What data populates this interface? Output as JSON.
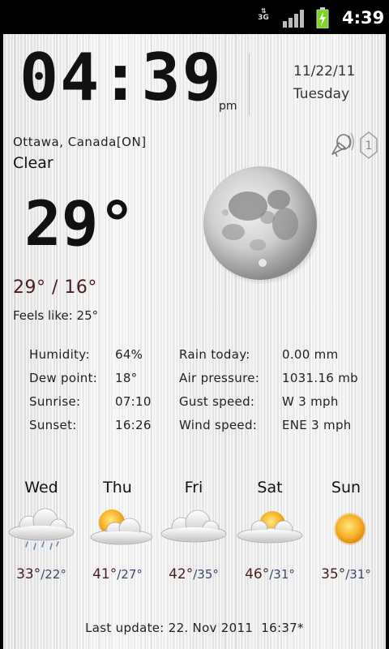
{
  "status_bar": {
    "network": "3G",
    "time": "4:39",
    "colors": {
      "battery": "#7ed321"
    }
  },
  "clock": {
    "time": "04:39",
    "ampm": "pm",
    "date": "11/22/11",
    "weekday": "Tuesday"
  },
  "current": {
    "location": "Ottawa, Canada[ON]",
    "condition": "Clear",
    "temperature": "29°",
    "high": "29°",
    "separator": " / ",
    "low": "16°",
    "feels_like": "Feels like: 25°",
    "icon": "full-moon-icon",
    "alert_count": "1"
  },
  "details_left": [
    {
      "label": "Humidity:",
      "value": "64%"
    },
    {
      "label": "Dew point:",
      "value": "18°"
    },
    {
      "label": "Sunrise:",
      "value": "07:10"
    },
    {
      "label": "Sunset:",
      "value": "16:26"
    }
  ],
  "details_right": [
    {
      "label": "Rain today:",
      "value": "0.00 mm"
    },
    {
      "label": "Air pressure:",
      "value": "1031.16 mb"
    },
    {
      "label": "Gust speed:",
      "value": "W 3 mph"
    },
    {
      "label": "Wind speed:",
      "value": "ENE 3 mph"
    }
  ],
  "forecast": [
    {
      "day": "Wed",
      "hi": "33°",
      "lo": "/22°",
      "icon": "rain-cloud-icon"
    },
    {
      "day": "Thu",
      "hi": "41°",
      "lo": "/27°",
      "icon": "partly-cloudy-icon"
    },
    {
      "day": "Fri",
      "hi": "42°",
      "lo": "/35°",
      "icon": "cloud-icon"
    },
    {
      "day": "Sat",
      "hi": "46°",
      "lo": "/31°",
      "icon": "partly-cloudy-icon"
    },
    {
      "day": "Sun",
      "hi": "35°",
      "lo": "/31°",
      "icon": "sun-icon"
    }
  ],
  "last_update": "Last update: 22. Nov 2011  16:37*",
  "colors": {
    "high_temp": "#4a1e1e",
    "low_temp": "#3a4a6a",
    "panel_bg": "#ededed",
    "sun": "#f5a623"
  }
}
